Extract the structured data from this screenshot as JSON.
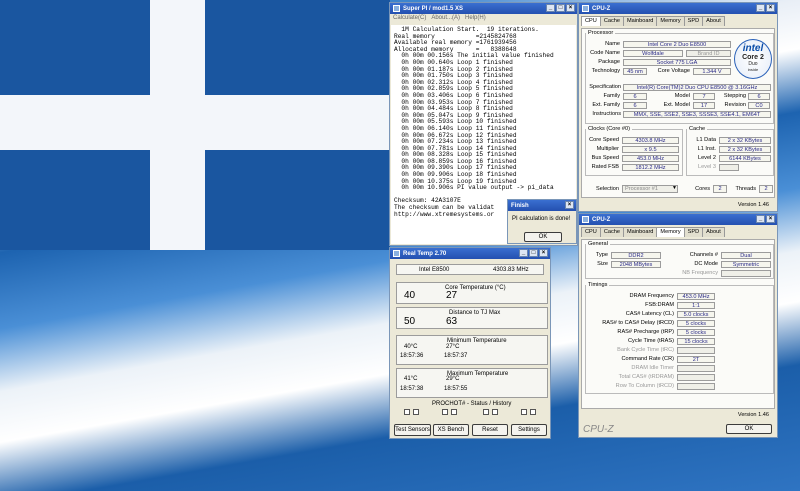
{
  "superpi": {
    "title": "Super PI / mod1.5 XS",
    "menu": [
      "Calculate(C)",
      "About...(A)",
      "Help(H)"
    ],
    "lines": [
      "  1M Calculation Start.  19 iterations.",
      "Real memory           =2145824768",
      "Available real memory =1761939456",
      "Allocated memory      =   8388648",
      "  0h 00m 00.156s The initial value finished",
      "  0h 00m 00.640s Loop 1 finished",
      "  0h 00m 01.187s Loop 2 finished",
      "  0h 00m 01.750s Loop 3 finished",
      "  0h 00m 02.312s Loop 4 finished",
      "  0h 00m 02.859s Loop 5 finished",
      "  0h 00m 03.406s Loop 6 finished",
      "  0h 00m 03.953s Loop 7 finished",
      "  0h 00m 04.484s Loop 8 finished",
      "  0h 00m 05.047s Loop 9 finished",
      "  0h 00m 05.593s Loop 10 finished",
      "  0h 00m 06.140s Loop 11 finished",
      "  0h 00m 06.672s Loop 12 finished",
      "  0h 00m 07.234s Loop 13 finished",
      "  0h 00m 07.781s Loop 14 finished",
      "  0h 00m 08.328s Loop 15 finished",
      "  0h 00m 08.859s Loop 16 finished",
      "  0h 00m 09.390s Loop 17 finished",
      "  0h 00m 09.906s Loop 18 finished",
      "  0h 00m 10.375s Loop 19 finished",
      "  0h 00m 10.906s PI value output -> pi_data",
      "",
      "Checksum: 42A3107E",
      "The checksum can be validat",
      "http://www.xtremesystems.or"
    ]
  },
  "finish": {
    "title": "Finish",
    "message": "PI calculation is done!",
    "ok": "OK"
  },
  "cpuz1": {
    "title": "CPU-Z",
    "tabs": [
      "CPU",
      "Cache",
      "Mainboard",
      "Memory",
      "SPD",
      "About"
    ],
    "processor": {
      "legend": "Processor",
      "name_label": "Name",
      "name": "Intel Core 2 Duo E8500",
      "code_label": "Code Name",
      "code": "Wolfdale",
      "brand_label": "Brand ID",
      "package_label": "Package",
      "package": "Socket 775 LGA",
      "tech_label": "Technology",
      "tech": "45 nm",
      "voltage_label": "Core Voltage",
      "voltage": "1.344 V",
      "spec_label": "Specification",
      "spec": "Intel(R) Core(TM)2 Duo CPU    E8500  @ 3.16GHz",
      "family_label": "Family",
      "family": "6",
      "model_label": "Model",
      "model": "7",
      "stepping_label": "Stepping",
      "stepping": "6",
      "extfam_label": "Ext. Family",
      "extfam": "6",
      "extmodel_label": "Ext. Model",
      "extmodel": "17",
      "revision_label": "Revision",
      "revision": "C0",
      "instr_label": "Instructions",
      "instr": "MMX, SSE, SSE2, SSE3, SSSE3, SSE4.1, EM64T"
    },
    "logo": {
      "brand": "intel",
      "line1": "Core 2",
      "line2": "Duo",
      "inside": "inside"
    },
    "clocks": {
      "legend": "Clocks (Core #0)",
      "speed_label": "Core Speed",
      "speed": "4303.8 MHz",
      "mult_label": "Multiplier",
      "mult": "x 9.5",
      "bus_label": "Bus Speed",
      "bus": "453.0 MHz",
      "fsb_label": "Rated FSB",
      "fsb": "1812.2 MHz"
    },
    "cache": {
      "legend": "Cache",
      "l1d_label": "L1 Data",
      "l1d": "2 x 32 KBytes",
      "l1i_label": "L1 Inst.",
      "l1i": "2 x 32 KBytes",
      "l2_label": "Level 2",
      "l2": "6144 KBytes",
      "l3_label": "Level 3"
    },
    "selection_label": "Selection",
    "selection": "Processor #1",
    "cores_label": "Cores",
    "cores": "2",
    "threads_label": "Threads",
    "threads": "2",
    "version": "Version 1.46"
  },
  "cpuz2": {
    "title": "CPU-Z",
    "tabs": [
      "CPU",
      "Cache",
      "Mainboard",
      "Memory",
      "SPD",
      "About"
    ],
    "general": {
      "legend": "General",
      "type_label": "Type",
      "type": "DDR2",
      "size_label": "Size",
      "size": "2048 MBytes",
      "channels_label": "Channels #",
      "channels": "Dual",
      "dc_label": "DC Mode",
      "dc": "Symmetric",
      "nb_label": "NB Frequency"
    },
    "timings": {
      "legend": "Timings",
      "dram_label": "DRAM Frequency",
      "dram": "453.0 MHz",
      "fsbdram_label": "FSB:DRAM",
      "fsbdram": "1:1",
      "cas_label": "CAS# Latency (CL)",
      "cas": "5.0 clocks",
      "rcd_label": "RAS# to CAS# Delay (tRCD)",
      "rcd": "5 clocks",
      "rp_label": "RAS# Precharge (tRP)",
      "rp": "5 clocks",
      "ras_label": "Cycle Time (tRAS)",
      "ras": "15 clocks",
      "rc_label": "Bank Cycle Time (tRC)",
      "cr_label": "Command Rate (CR)",
      "cr": "2T",
      "idle_label": "DRAM Idle Timer",
      "rdram_label": "Total CAS# (tRDRAM)",
      "rcdr_label": "Row To Column (tRCD)"
    },
    "version": "Version 1.46",
    "brand": "CPU-Z",
    "ok": "OK"
  },
  "realtemp": {
    "title": "Real Temp 2.70",
    "cpu": "Intel E8500",
    "mhz": "4303.83 MHz",
    "core_temp_label": "Core Temperature (°C)",
    "core_temp": [
      "40",
      "27"
    ],
    "tjmax_label": "Distance to TJ Max",
    "tjmax": [
      "50",
      "63"
    ],
    "min_label": "Minimum Temperature",
    "min": [
      {
        "temp": "40°C",
        "time": "18:57:36"
      },
      {
        "temp": "27°C",
        "time": "18:57:37"
      }
    ],
    "max_label": "Maximum Temperature",
    "max": [
      {
        "temp": "41°C",
        "time": "18:57:38"
      },
      {
        "temp": "29°C",
        "time": "18:57:55"
      }
    ],
    "prochot_label": "PROCHOT#  -  Status / History",
    "buttons": [
      "Test Sensors",
      "XS Bench",
      "Reset",
      "Settings"
    ]
  }
}
